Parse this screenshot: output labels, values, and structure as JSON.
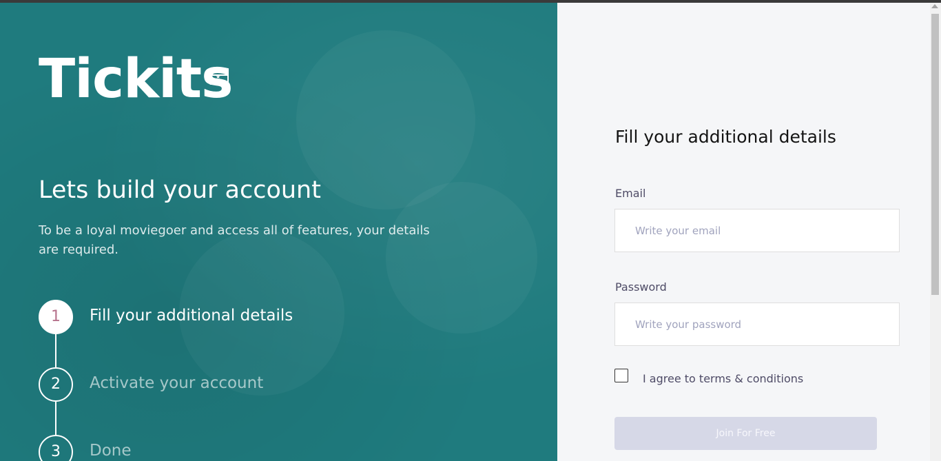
{
  "brand": {
    "logo_text": "Tickits"
  },
  "left": {
    "heading": "Lets build your account",
    "subheading": "To be a loyal moviegoer and access all of features, your details are required.",
    "steps": [
      {
        "number": "1",
        "label": "Fill your additional details",
        "state": "active"
      },
      {
        "number": "2",
        "label": "Activate your account",
        "state": "pending"
      },
      {
        "number": "3",
        "label": "Done",
        "state": "pending"
      }
    ]
  },
  "form": {
    "title": "Fill your additional details",
    "email_label": "Email",
    "email_placeholder": "Write your email",
    "email_value": "",
    "password_label": "Password",
    "password_placeholder": "Write your password",
    "password_value": "",
    "terms_label": "I agree to terms & conditions",
    "terms_checked": false,
    "submit_label": "Join For Free"
  },
  "colors": {
    "primary_teal": "#1f7b7e",
    "step_active_number": "#b6728c",
    "button_disabled": "#d6d8e7"
  }
}
